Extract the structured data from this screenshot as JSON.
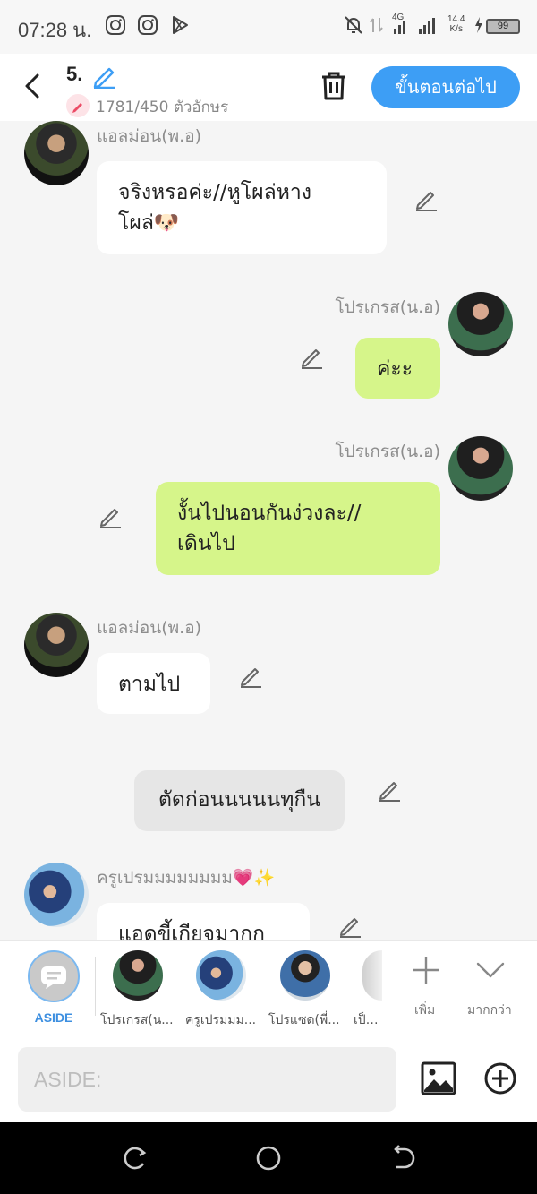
{
  "status_bar": {
    "time": "07:28 น.",
    "network": "4G",
    "speed": "14.4",
    "speed_unit": "K/s",
    "battery": "99"
  },
  "header": {
    "episode": "5.",
    "char_count": "1781/450 ตัวอักษร",
    "next_label": "ขั้นตอนต่อไป"
  },
  "messages": [
    {
      "name": "แอลม่อน(พ.อ)",
      "text": "จริงหรอค่ะ//หูโผล่หาง\nโผล่🐶"
    },
    {
      "name": "โปรเกรส(น.อ)",
      "text": "ค่ะะ"
    },
    {
      "name": "โปรเกรส(น.อ)",
      "text": "งั้นไปนอนกันง่วงละ//\nเดินไป"
    },
    {
      "name": "แอลม่อน(พ.อ)",
      "text": "ตามไป"
    },
    {
      "text": "ตัดก่อนนนนนทุกืน"
    },
    {
      "name": "ครูเปรมมมมมมมม💗✨",
      "text": "แอดขี้เกียจมากก"
    }
  ],
  "characters": {
    "aside_label": "ASIDE",
    "items": [
      "โปรเกรส(น...",
      "ครูเปรมมม...",
      "โปรแซด(พี่...",
      "เป็นพ"
    ],
    "add_label": "เพิ่ม",
    "more_label": "มากกว่า"
  },
  "input": {
    "placeholder": "ASIDE:"
  },
  "colors": {
    "accent": "#3d9ef5",
    "bubble_green": "#d6f58a",
    "bubble_white": "#ffffff",
    "narration_gray": "#e6e6e6"
  }
}
